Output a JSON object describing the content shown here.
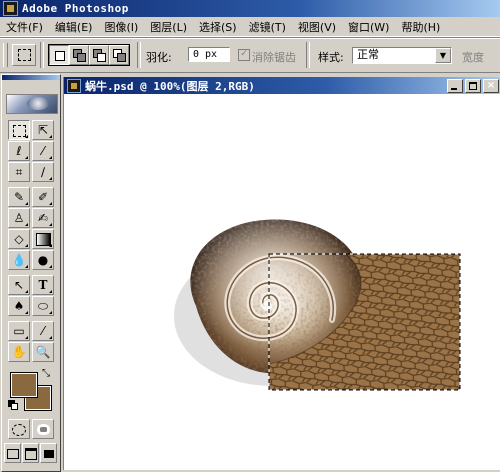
{
  "app": {
    "title": "Adobe Photoshop"
  },
  "menu": [
    "文件(F)",
    "编辑(E)",
    "图像(I)",
    "图层(L)",
    "选择(S)",
    "滤镜(T)",
    "视图(V)",
    "窗口(W)",
    "帮助(H)"
  ],
  "options": {
    "feather_label": "羽化:",
    "feather_value": "0 px",
    "antialias_label": "消除锯齿",
    "style_label": "样式:",
    "style_value": "正常",
    "width_label": "宽度"
  },
  "document": {
    "title": "蜗牛.psd @ 100%(图层 2,RGB)"
  },
  "colors": {
    "foreground": "#8a6840",
    "background": "#8a6840",
    "title_bar": "#0a246a"
  },
  "tools": [
    "marquee-icon",
    "move-icon",
    "lasso-icon",
    "magic-wand-icon",
    "crop-icon",
    "slice-icon",
    "healing-brush-icon",
    "brush-icon",
    "clone-stamp-icon",
    "history-brush-icon",
    "eraser-icon",
    "gradient-icon",
    "blur-icon",
    "dodge-icon",
    "path-selection-icon",
    "type-icon",
    "pen-icon",
    "shape-icon",
    "notes-icon",
    "eyedropper-icon",
    "hand-icon",
    "zoom-icon"
  ]
}
